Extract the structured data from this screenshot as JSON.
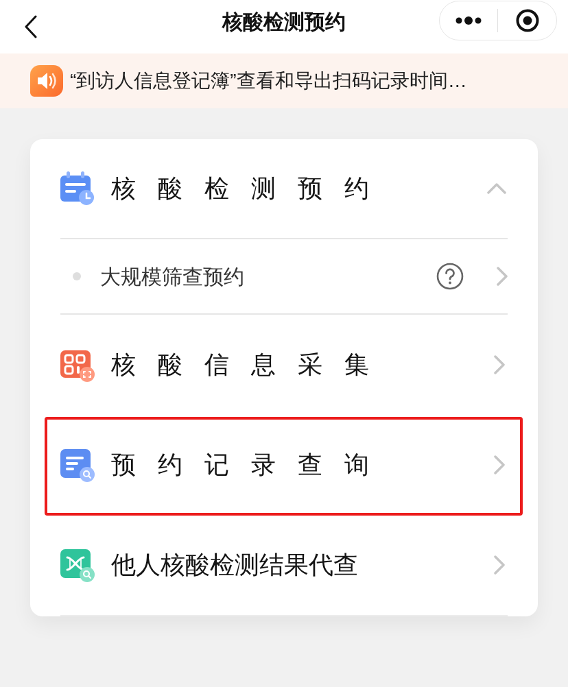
{
  "nav": {
    "title": "核酸检测预约"
  },
  "notice": {
    "text": "“到访人信息登记簿”查看和导出扫码记录时间…"
  },
  "menu": [
    {
      "kind": "group",
      "label": "核 酸 检 测 预 约",
      "expanded": true,
      "highlighted": false,
      "children": [
        {
          "label": "大规模筛查预约",
          "help": true
        }
      ]
    },
    {
      "kind": "link",
      "label": "核 酸 信 息 采 集",
      "highlighted": false
    },
    {
      "kind": "link",
      "label": "预 约 记 录 查 询",
      "highlighted": true
    },
    {
      "kind": "link",
      "label": "他人核酸检测结果代查",
      "highlighted": false
    }
  ]
}
